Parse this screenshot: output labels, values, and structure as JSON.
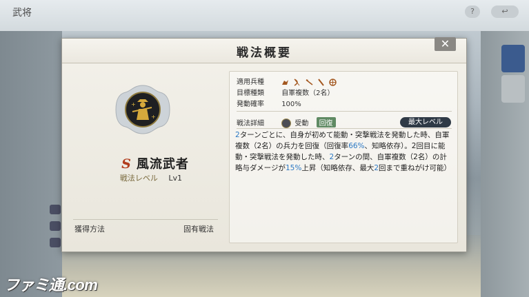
{
  "background": {
    "title": "武将",
    "famitsu_logo": "ファミ通.com"
  },
  "dialog": {
    "title": "戦法概要",
    "close_icon": "close-icon"
  },
  "skill": {
    "rank": "S",
    "name": "風流武者",
    "level_label": "戦法レベル",
    "level_value": "Lv1",
    "acquisition_label": "獲得方法",
    "acquisition_value": "固有戦法",
    "emblem_icon": "samurai-emblem-icon"
  },
  "info": {
    "unit_label": "適用兵種",
    "unit_icons": [
      "cavalry-icon",
      "bow-icon",
      "spear-icon",
      "sword-icon",
      "shield-icon"
    ],
    "target_label": "目標種類",
    "target_value": "自軍複数（2名）",
    "rate_label": "発動確率",
    "rate_value": "100%",
    "detail_label": "戦法詳細",
    "trigger_type": "受動",
    "effect_tag": "回復",
    "max_level_button": "最大レベル"
  },
  "description": {
    "p1": "2",
    "p2": "ターンごとに、自身が初めて能動・突撃戦法を発動した時、自軍複数（2名）の兵力を回復（回復率",
    "p3": "66%",
    "p4": "、知略依存）。2回目に能動・突撃戦法を発動した時、",
    "p5": "2",
    "p6": "ターンの間、自軍複数（2名）の計略与ダメージが",
    "p7": "15%",
    "p8": "上昇（知略依存、最大",
    "p9": "2",
    "p10": "回まで重ねがけ可能）"
  }
}
